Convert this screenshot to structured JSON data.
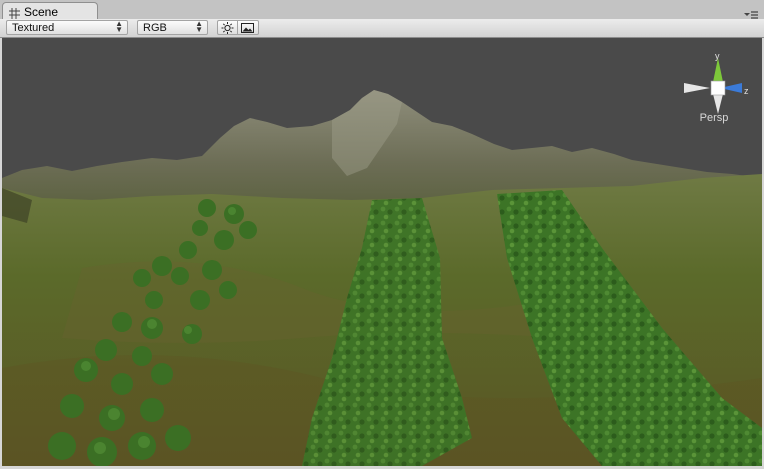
{
  "window": {
    "tab_label": "Scene",
    "tab_icon": "scene-grid-icon",
    "menu_icon": "panel-menu-icon"
  },
  "toolbar": {
    "render_mode": "Textured",
    "channel_mode": "RGB",
    "lighting_icon": "sun-icon",
    "fx_icon": "image-icon"
  },
  "viewport": {
    "gizmo_label": "Persp",
    "axis_labels": {
      "y": "y",
      "z": "z"
    },
    "colors": {
      "background": "#4a4a4a",
      "grass": "#5d6e2a",
      "rock": "#6f705a",
      "trees": "#3f7a28"
    }
  }
}
